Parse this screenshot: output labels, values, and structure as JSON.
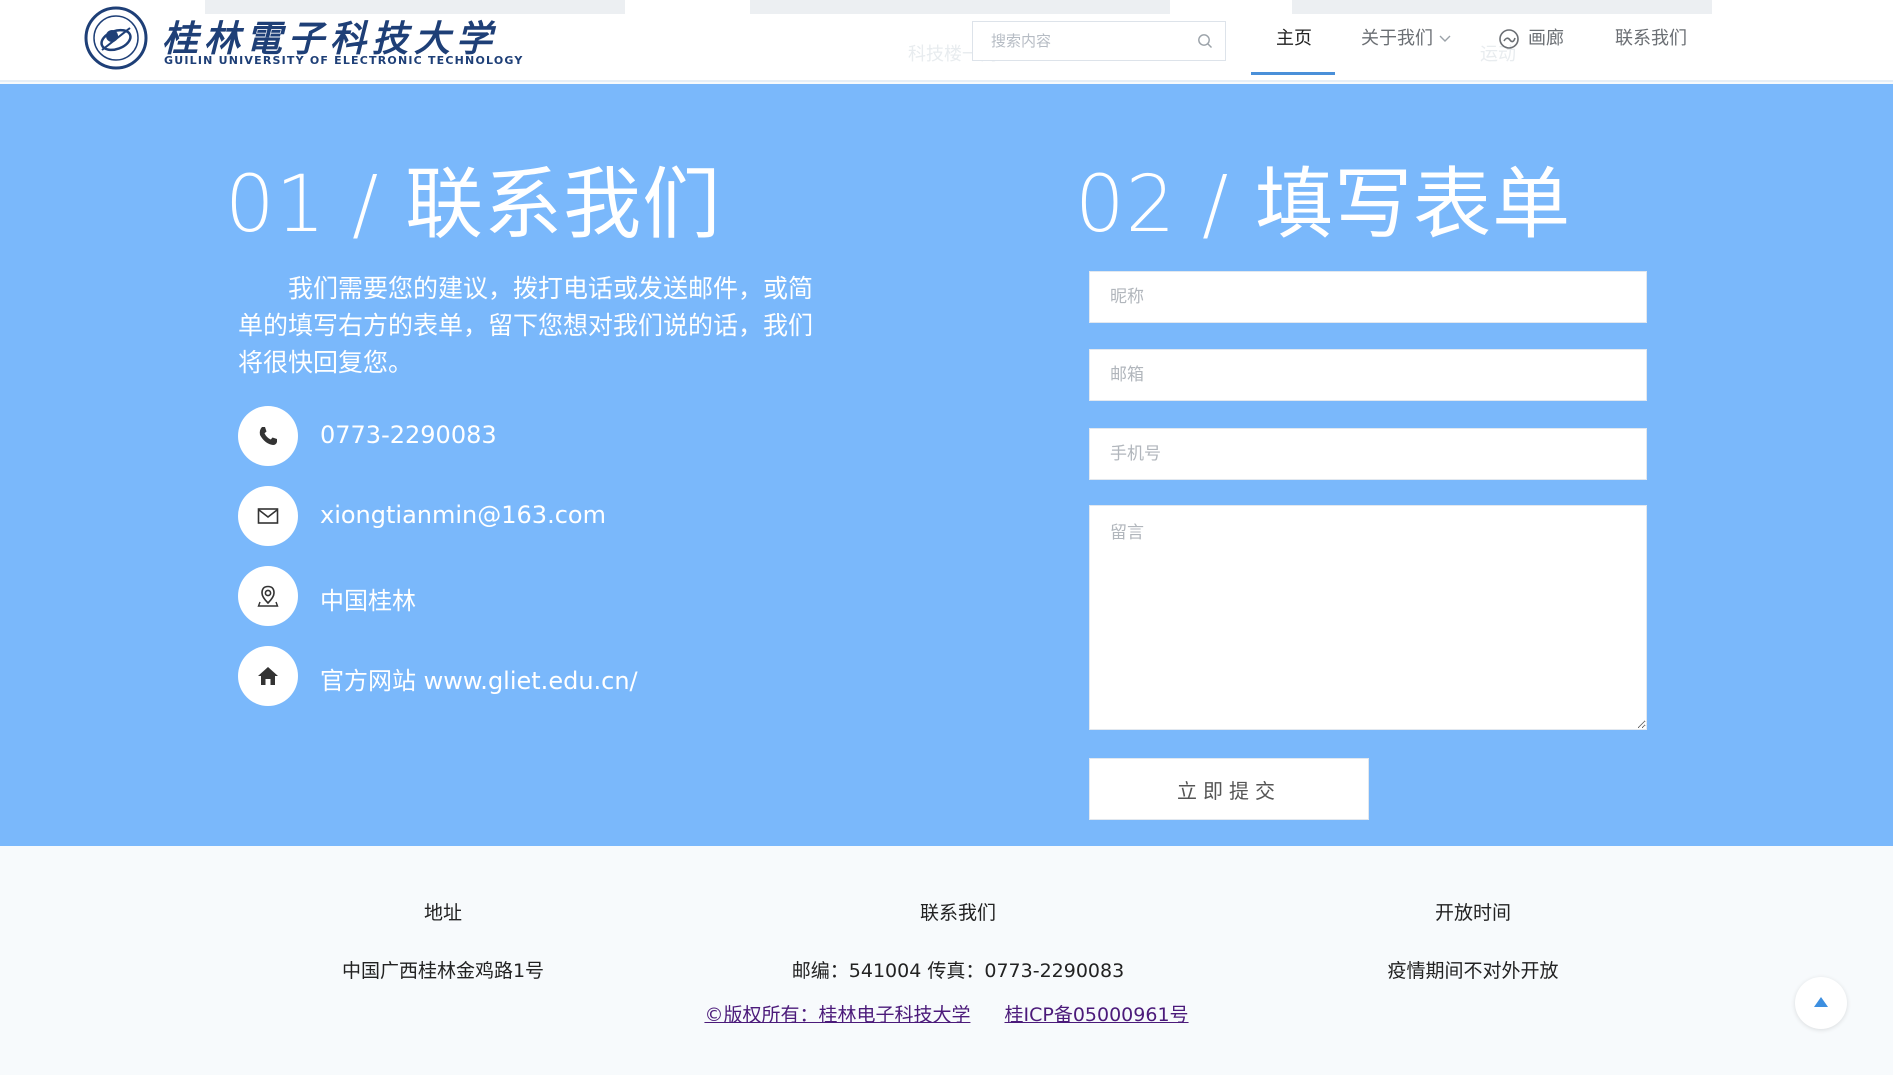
{
  "header": {
    "logo": {
      "cn_name": "桂林電子科技大学",
      "en_name": "GUILIN UNIVERSITY OF ELECTRONIC TECHNOLOGY",
      "seal_icon": "university-seal-icon"
    },
    "ghost_texts": [
      "科技楼一角",
      "运动"
    ],
    "search": {
      "placeholder": "搜索内容",
      "icon": "search-icon"
    },
    "nav": {
      "home": "主页",
      "about": "关于我们",
      "gallery": "画廊",
      "contact": "联系我们",
      "active": "home"
    }
  },
  "contact_section": {
    "title_left": "01 / 联系我们",
    "title_right": "02 / 填写表单",
    "intro": "我们需要您的建议，拨打电话或发送邮件，或简单的填写右方的表单，留下您想对我们说的话，我们将很快回复您。",
    "items": [
      {
        "icon": "phone-icon",
        "text": "0773-2290083"
      },
      {
        "icon": "mail-icon",
        "text": "xiongtianmin@163.com"
      },
      {
        "icon": "location-icon",
        "text": "中国桂林"
      },
      {
        "icon": "home-icon",
        "text": "官方网站 www.gliet.edu.cn/"
      }
    ]
  },
  "form": {
    "nickname_placeholder": "昵称",
    "email_placeholder": "邮箱",
    "phone_placeholder": "手机号",
    "message_placeholder": "留言",
    "submit_label": "立即提交"
  },
  "footer": {
    "columns": [
      {
        "heading": "地址",
        "value": "中国广西桂林金鸡路1号"
      },
      {
        "heading": "联系我们",
        "value": "邮编：541004 传真：0773-2290083"
      },
      {
        "heading": "开放时间",
        "value": "疫情期间不对外开放"
      }
    ],
    "copyright": "©版权所有：桂林电子科技大学",
    "icp": "桂ICP备05000961号"
  },
  "colors": {
    "band_bg": "#7ab8fb",
    "nav_underline": "#4a90d9",
    "logo_blue": "#1e3f77",
    "link_purple": "#4b1a7a"
  }
}
